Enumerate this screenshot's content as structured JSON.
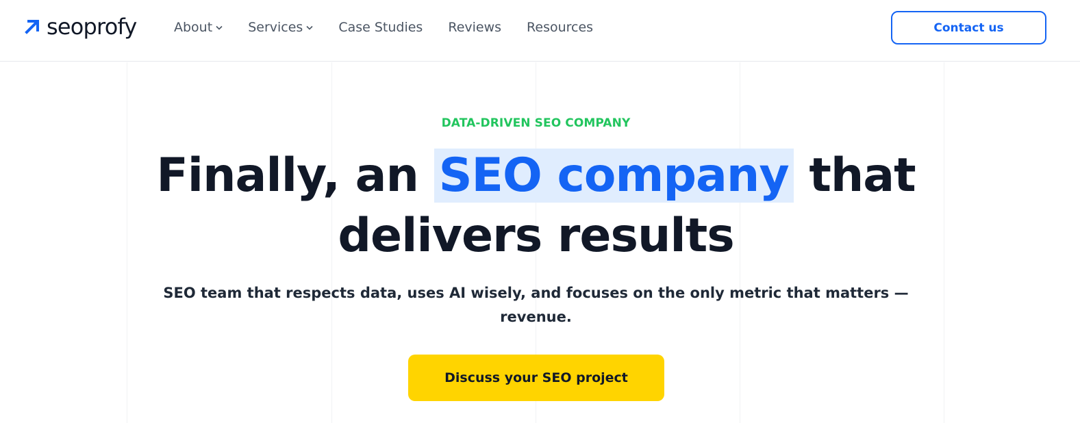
{
  "header": {
    "logo_text": "seoprofy",
    "nav": [
      {
        "label": "About",
        "has_dropdown": true
      },
      {
        "label": "Services",
        "has_dropdown": true
      },
      {
        "label": "Case Studies",
        "has_dropdown": false
      },
      {
        "label": "Reviews",
        "has_dropdown": false
      },
      {
        "label": "Resources",
        "has_dropdown": false
      }
    ],
    "contact_label": "Contact us"
  },
  "hero": {
    "eyebrow": "DATA-DRIVEN SEO COMPANY",
    "headline_part1": "Finally, an ",
    "headline_highlight": "SEO company",
    "headline_part2": " that",
    "headline_line2": "delivers results",
    "subtitle": "SEO team that respects data, uses AI wisely, and focuses on the only metric that matters — revenue.",
    "cta_label": "Discuss your SEO project"
  },
  "colors": {
    "brand_blue": "#1464f4",
    "eyebrow_green": "#22c55e",
    "highlight_bg": "#e0edfe",
    "cta_yellow": "#ffd400",
    "text_dark": "#111827"
  },
  "icons": {
    "logo": "arrow-up-right-icon",
    "dropdown": "chevron-down-icon"
  }
}
